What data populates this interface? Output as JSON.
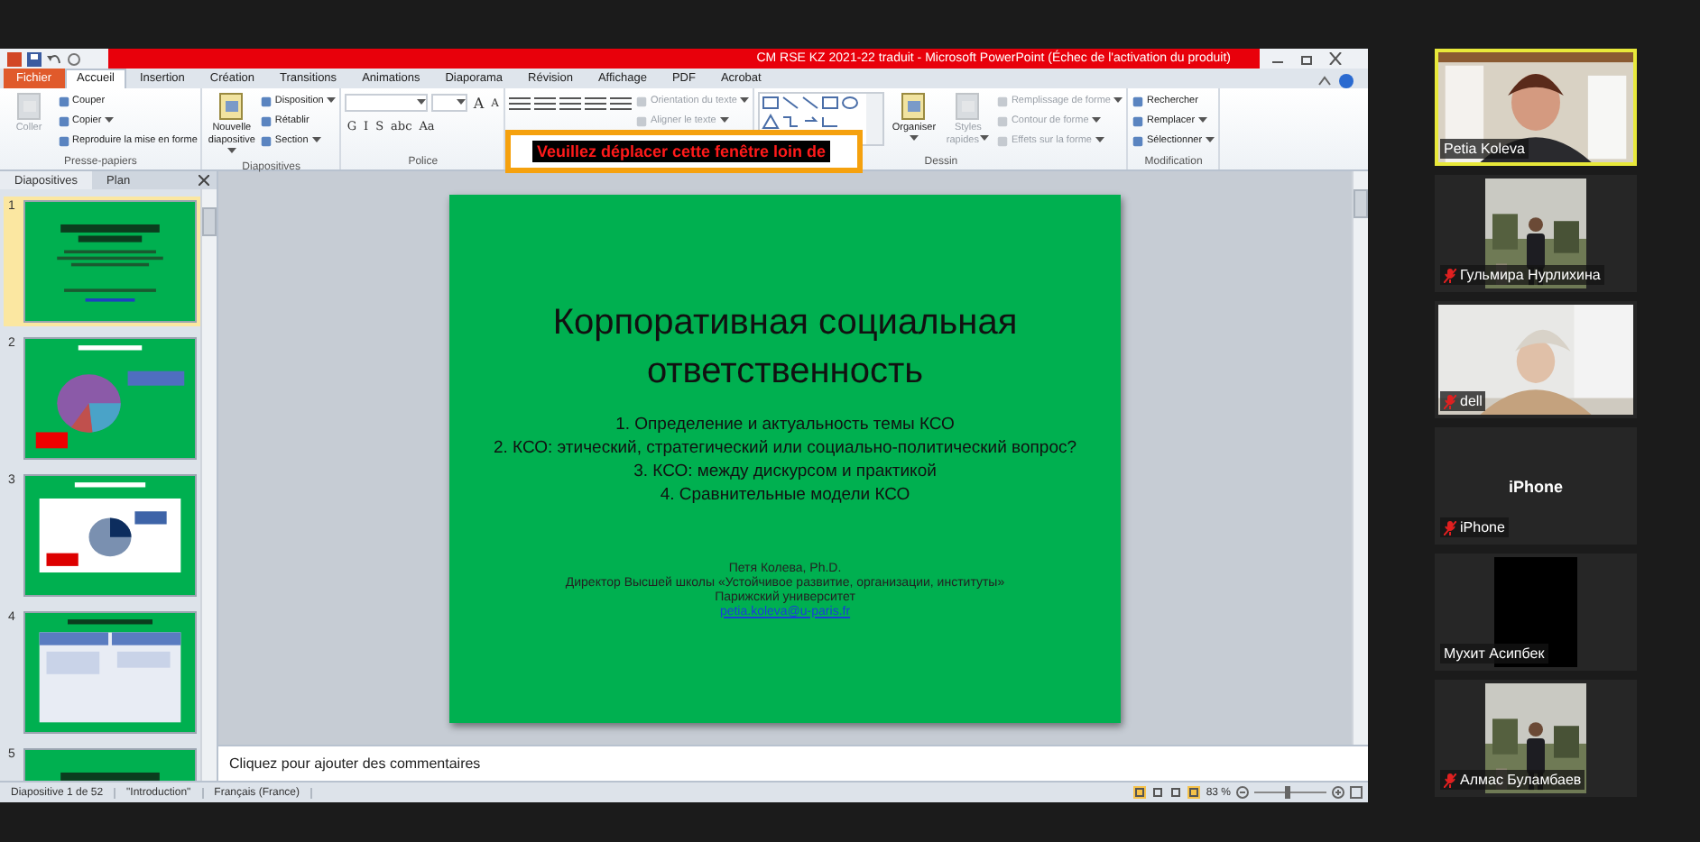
{
  "window": {
    "title": "CM RSE KZ 2021-22 traduit  -  Microsoft PowerPoint (Échec de l'activation du produit)"
  },
  "tabs": [
    {
      "label": "Fichier",
      "kind": "file",
      "selected": false
    },
    {
      "label": "Accueil",
      "kind": "tab",
      "selected": true
    },
    {
      "label": "Insertion",
      "kind": "tab",
      "selected": false
    },
    {
      "label": "Création",
      "kind": "tab",
      "selected": false
    },
    {
      "label": "Transitions",
      "kind": "tab",
      "selected": false
    },
    {
      "label": "Animations",
      "kind": "tab",
      "selected": false
    },
    {
      "label": "Diaporama",
      "kind": "tab",
      "selected": false
    },
    {
      "label": "Révision",
      "kind": "tab",
      "selected": false
    },
    {
      "label": "Affichage",
      "kind": "tab",
      "selected": false
    },
    {
      "label": "PDF",
      "kind": "tab",
      "selected": false
    },
    {
      "label": "Acrobat",
      "kind": "tab",
      "selected": false
    }
  ],
  "ribbon": {
    "groups": [
      {
        "name": "Presse-papiers",
        "items": [
          {
            "kind": "large",
            "label": "Coller",
            "disabled": true,
            "dropdown": false
          },
          {
            "kind": "small",
            "label": "Couper",
            "disabled": false,
            "dropdown": false
          },
          {
            "kind": "small",
            "label": "Copier",
            "disabled": false,
            "dropdown": true
          },
          {
            "kind": "small",
            "label": "Reproduire la mise en forme",
            "disabled": false,
            "dropdown": false
          }
        ]
      },
      {
        "name": "Diapositives",
        "items": [
          {
            "kind": "large",
            "label": "Nouvelle diapositive",
            "disabled": false,
            "dropdown": true
          },
          {
            "kind": "small",
            "label": "Disposition",
            "disabled": false,
            "dropdown": true
          },
          {
            "kind": "small",
            "label": "Rétablir",
            "disabled": false,
            "dropdown": false
          },
          {
            "kind": "small",
            "label": "Section",
            "disabled": false,
            "dropdown": true
          }
        ]
      },
      {
        "name": "Police",
        "items": [
          {
            "kind": "font",
            "buttons": [
              "G",
              "I",
              "S",
              "abc",
              "Aa"
            ],
            "size_buttons": [
              "A",
              "A"
            ]
          }
        ]
      },
      {
        "items": [
          {
            "kind": "paragraph"
          },
          {
            "kind": "small",
            "label": "Orientation du texte",
            "disabled": true,
            "dropdown": true
          },
          {
            "kind": "small",
            "label": "Aligner le texte",
            "disabled": true,
            "dropdown": true
          }
        ]
      },
      {
        "name": "Dessin",
        "items": [
          {
            "kind": "gallery"
          },
          {
            "kind": "large",
            "label": "Organiser",
            "disabled": false,
            "dropdown": true
          },
          {
            "kind": "large",
            "label": "Styles rapides",
            "disabled": true,
            "dropdown": true
          },
          {
            "kind": "small",
            "label": "Remplissage de forme",
            "disabled": true,
            "dropdown": true
          },
          {
            "kind": "small",
            "label": "Contour de forme",
            "disabled": true,
            "dropdown": true
          },
          {
            "kind": "small",
            "label": "Effets sur la forme",
            "disabled": true,
            "dropdown": true
          }
        ]
      },
      {
        "name": "Modification",
        "items": [
          {
            "kind": "small",
            "label": "Rechercher",
            "disabled": false,
            "dropdown": false
          },
          {
            "kind": "small",
            "label": "Remplacer",
            "disabled": false,
            "dropdown": true
          },
          {
            "kind": "small",
            "label": "Sélectionner",
            "disabled": false,
            "dropdown": true
          }
        ]
      }
    ]
  },
  "overlay": {
    "text": "Veuillez déplacer cette fenêtre loin de"
  },
  "slide_panel": {
    "tabs": [
      {
        "label": "Diapositives",
        "selected": true
      },
      {
        "label": "Plan",
        "selected": false
      }
    ],
    "slides": [
      {
        "number": "1",
        "kind": "title",
        "selected": true
      },
      {
        "number": "2",
        "kind": "pie",
        "selected": false
      },
      {
        "number": "3",
        "kind": "chart",
        "selected": false
      },
      {
        "number": "4",
        "kind": "table",
        "selected": false
      },
      {
        "number": "5",
        "kind": "title",
        "selected": false
      }
    ]
  },
  "slide": {
    "title": "Корпоративная социальная ответственность",
    "items": [
      "1. Определение и актуальность темы КСО",
      "2. КСО: этический, стратегический или социально-политический вопрос?",
      "3. КСО: между дискурсом и практикой",
      "4. Сравнительные модели КСО"
    ],
    "author": [
      "Петя Колева, Ph.D.",
      "Директор Высшей школы «Устойчивое развитие, организации, институты»",
      "Парижский университет"
    ],
    "email": "petia.koleva@u-paris.fr"
  },
  "notes": {
    "placeholder": "Cliquez pour ajouter des commentaires"
  },
  "status_bar": {
    "items": [
      "Diapositive 1 de 52",
      "\"Introduction\"",
      "Français (France)"
    ],
    "zoom": {
      "label": "83 %",
      "level": 0.45
    }
  },
  "participants": [
    {
      "name": "Petia Koleva",
      "muted": false,
      "speaking": true,
      "kind": "picture"
    },
    {
      "name": "Гульмира Нурлихина",
      "muted": true,
      "speaking": false,
      "kind": "portrait"
    },
    {
      "name": "dell",
      "muted": true,
      "speaking": false,
      "kind": "picture"
    },
    {
      "name": "iPhone",
      "muted": true,
      "speaking": false,
      "kind": "name",
      "display_name": "iPhone"
    },
    {
      "name": "Мухит Асипбек",
      "muted": false,
      "speaking": false,
      "kind": "black"
    },
    {
      "name": "Алмас Буламбаев",
      "muted": true,
      "speaking": false,
      "kind": "portrait"
    }
  ]
}
